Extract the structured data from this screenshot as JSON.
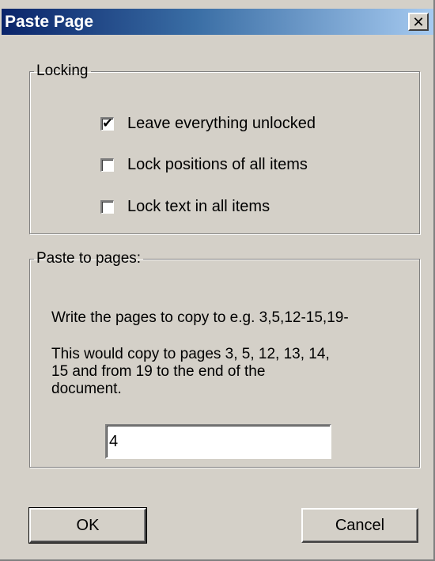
{
  "window": {
    "title": "Paste Page",
    "close_glyph": "✕"
  },
  "locking": {
    "legend": "Locking",
    "options": [
      {
        "label": "Leave everything unlocked",
        "checked": true
      },
      {
        "label": "Lock positions of all items",
        "checked": false
      },
      {
        "label": "Lock text in all items",
        "checked": false
      }
    ]
  },
  "paste": {
    "legend": "Paste to pages:",
    "instruction": "Write the pages to copy to e.g. 3,5,12-15,19-",
    "explanation_lines": [
      "This would copy to pages 3, 5, 12, 13, 14,",
      "15 and from 19 to the end of the",
      "document."
    ],
    "pages_value": "4"
  },
  "buttons": {
    "ok_label": "OK",
    "cancel_label": "Cancel"
  }
}
